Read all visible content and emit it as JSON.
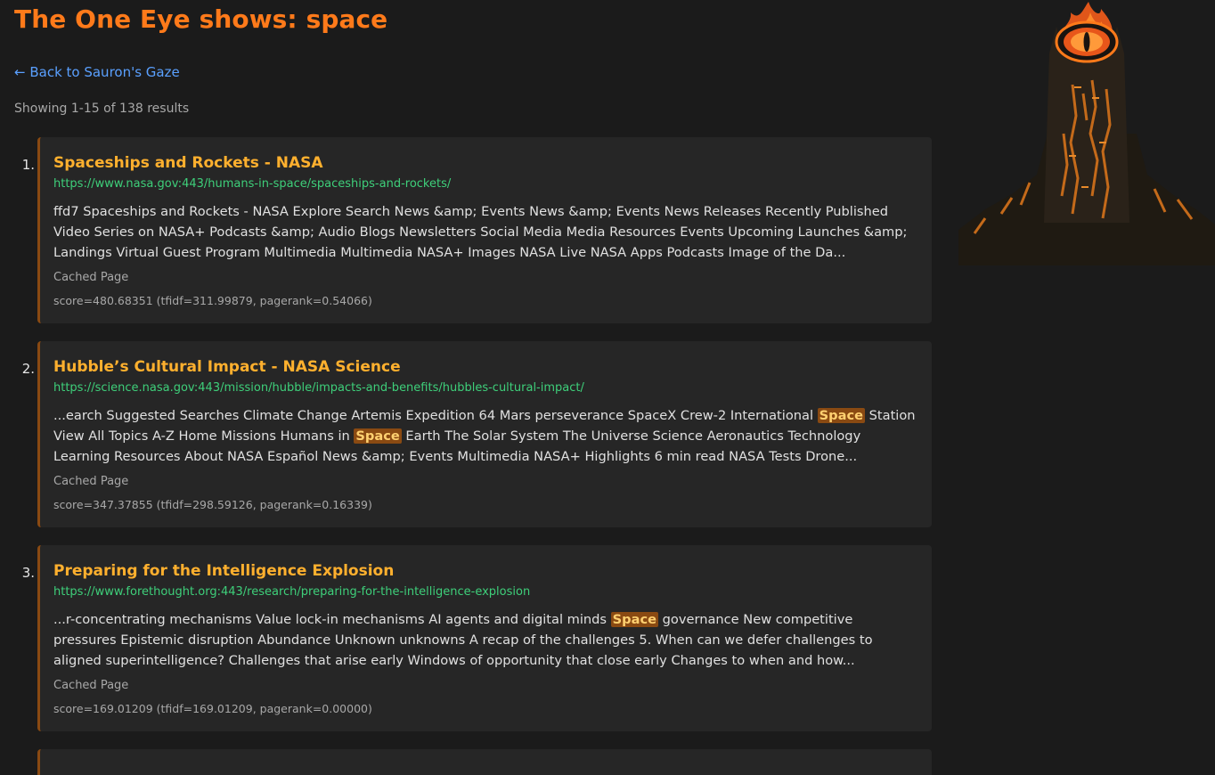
{
  "header": {
    "title": "The One Eye shows: space",
    "back_link": "← Back to Sauron's Gaze",
    "showing": "Showing 1-15 of 138 results"
  },
  "results": [
    {
      "num": "1.",
      "title": "Spaceships and Rockets - NASA",
      "url": "https://www.nasa.gov:443/humans-in-space/spaceships-and-rockets/",
      "snippet": [
        {
          "text": "ffd7 Spaceships and Rockets - NASA Explore Search News &amp; Events News &amp; Events News Releases Recently Published Video Series on NASA+ Podcasts &amp; Audio Blogs Newsletters Social Media Media Resources Events Upcoming Launches &amp; Landings Virtual Guest Program Multimedia Multimedia NASA+ Images NASA Live NASA Apps Podcasts Image of the Da...",
          "hl": false
        }
      ],
      "cached": "Cached Page",
      "score": "score=480.68351 (tfidf=311.99879, pagerank=0.54066)"
    },
    {
      "num": "2.",
      "title": "Hubble’s Cultural Impact - NASA Science",
      "url": "https://science.nasa.gov:443/mission/hubble/impacts-and-benefits/hubbles-cultural-impact/",
      "snippet": [
        {
          "text": "...earch Suggested Searches Climate Change Artemis Expedition 64 Mars perseverance SpaceX Crew-2 International ",
          "hl": false
        },
        {
          "text": "Space",
          "hl": true
        },
        {
          "text": " Station View All Topics A-Z Home Missions Humans in ",
          "hl": false
        },
        {
          "text": "Space",
          "hl": true
        },
        {
          "text": " Earth The Solar System The Universe Science Aeronautics Technology Learning Resources About NASA Español News &amp; Events Multimedia NASA+ Highlights 6 min read NASA Tests Drone...",
          "hl": false
        }
      ],
      "cached": "Cached Page",
      "score": "score=347.37855 (tfidf=298.59126, pagerank=0.16339)"
    },
    {
      "num": "3.",
      "title": "Preparing for the Intelligence Explosion",
      "url": "https://www.forethought.org:443/research/preparing-for-the-intelligence-explosion",
      "snippet": [
        {
          "text": "...r-concentrating mechanisms Value lock-in mechanisms AI agents and digital minds ",
          "hl": false
        },
        {
          "text": "Space",
          "hl": true
        },
        {
          "text": " governance New competitive pressures Epistemic disruption Abundance Unknown unknowns A recap of the challenges 5. When can we defer challenges to aligned superintelligence? Challenges that arise early Windows of opportunity that close early Changes to when and how...",
          "hl": false
        }
      ],
      "cached": "Cached Page",
      "score": "score=169.01209 (tfidf=169.01209, pagerank=0.00000)"
    }
  ],
  "colors": {
    "accent": "#ff7a1a",
    "result_title": "#ffb02e",
    "url": "#3ecf7a",
    "link": "#5aa0ff",
    "highlight_bg": "#8a4a12"
  },
  "icons": {
    "logo": "eye-of-sauron-tower-icon"
  }
}
